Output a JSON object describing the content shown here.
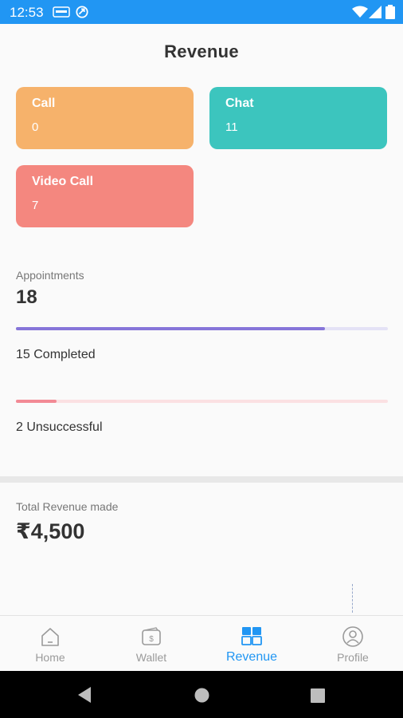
{
  "status_bar": {
    "time": "12:53",
    "bg_color": "#2196F3"
  },
  "header": {
    "title": "Revenue"
  },
  "cards": {
    "call": {
      "label": "Call",
      "value": "0",
      "color": "#F6B26B"
    },
    "chat": {
      "label": "Chat",
      "value": "11",
      "color": "#3CC5BE"
    },
    "video_call": {
      "label": "Video Call",
      "value": "7",
      "color": "#F4877F"
    }
  },
  "appointments": {
    "label": "Appointments",
    "total": "18",
    "completed": {
      "text": "15 Completed",
      "progress": 0.83,
      "color": "#8675D9"
    },
    "unsuccessful": {
      "text": "2 Unsuccessful",
      "progress": 0.11,
      "color": "#F28A95"
    }
  },
  "revenue": {
    "label": "Total Revenue made",
    "value": "₹4,500"
  },
  "bottom_nav": {
    "items": [
      {
        "label": "Home",
        "icon": "home-icon",
        "active": false
      },
      {
        "label": "Wallet",
        "icon": "wallet-icon",
        "active": false
      },
      {
        "label": "Revenue",
        "icon": "revenue-icon",
        "active": true
      },
      {
        "label": "Profile",
        "icon": "profile-icon",
        "active": false
      }
    ],
    "active_color": "#2196F3"
  },
  "system_nav": {
    "icons": [
      "back-icon",
      "home-circle-icon",
      "recents-icon"
    ]
  }
}
